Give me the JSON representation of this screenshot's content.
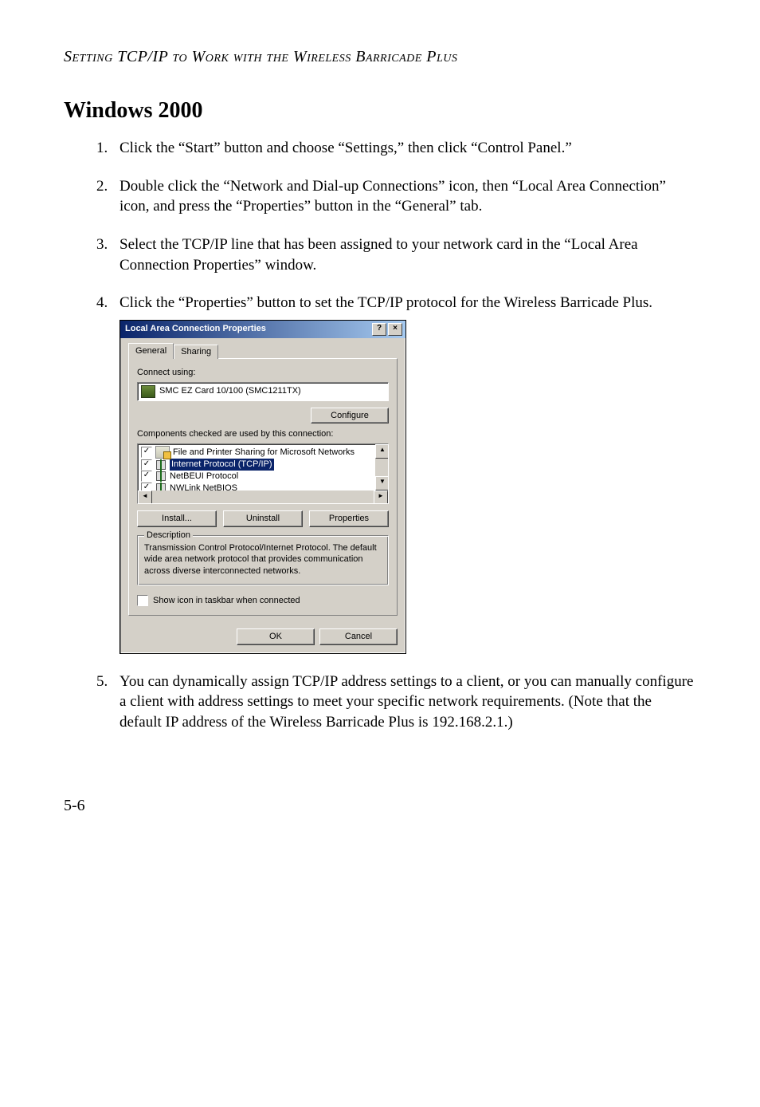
{
  "header": {
    "running_title": "Setting TCP/IP to Work with the Wireless Barricade Plus"
  },
  "section": {
    "title": "Windows 2000"
  },
  "steps": {
    "s1": "Click the “Start” button and choose “Settings,” then click “Control Panel.”",
    "s2": "Double click the “Network and Dial-up Connections” icon, then “Local Area Connection” icon, and press the “Properties” button in the “General” tab.",
    "s3": "Select the TCP/IP line that has been assigned to your network card in the “Local Area Connection Properties” window.",
    "s4": "Click the “Properties” button to set the TCP/IP protocol for the Wireless Barricade Plus.",
    "s5": "You can dynamically assign TCP/IP address settings to a client, or you can manually configure a client with address settings to meet your specific network requirements. (Note that the default IP address of the Wireless Barricade Plus is 192.168.2.1.)"
  },
  "dialog": {
    "title": "Local Area Connection Properties",
    "help_btn": "?",
    "close_btn": "×",
    "tabs": {
      "general": "General",
      "sharing": "Sharing"
    },
    "connect_using_label": "Connect using:",
    "adapter": "SMC EZ Card 10/100 (SMC1211TX)",
    "configure_btn": "Configure",
    "components_label": "Components checked are used by this connection:",
    "items": {
      "file_printer": "File and Printer Sharing for Microsoft Networks",
      "tcpip": "Internet Protocol (TCP/IP)",
      "netbeui": "NetBEUI Protocol",
      "nwlink": "NWLink NetBIOS"
    },
    "install_btn": "Install...",
    "uninstall_btn": "Uninstall",
    "properties_btn": "Properties",
    "description_label": "Description",
    "description_text": "Transmission Control Protocol/Internet Protocol. The default wide area network protocol that provides communication across diverse interconnected networks.",
    "show_icon_label": "Show icon in taskbar when connected",
    "ok_btn": "OK",
    "cancel_btn": "Cancel"
  },
  "footer": {
    "page_number": "5-6"
  }
}
